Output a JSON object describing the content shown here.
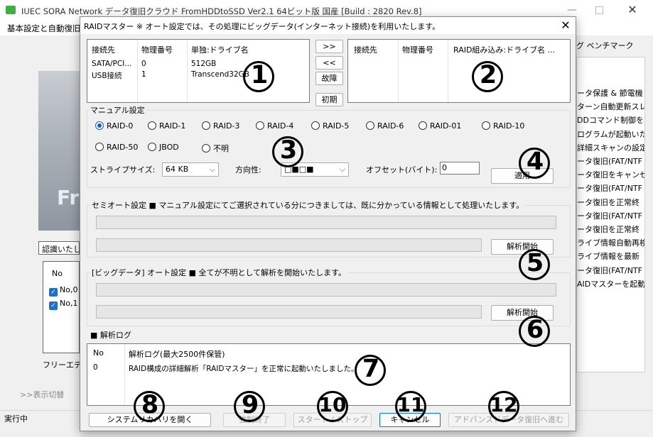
{
  "window": {
    "title": "IUEC SORA Network データ復旧クラウド FromHDDtoSSD Ver2.1 64ビット版 国産 [Build : 2820 Rev.8]",
    "menu_left": "基本設定と自動復旧",
    "menu_right": "グ ベンチマーク",
    "left_panel": {
      "hidden_label": "認識いたし",
      "list_header": "No",
      "rows": [
        "No,0",
        "No,1"
      ],
      "footer": "フリーエデ",
      "toggle": ">>表示切替"
    },
    "right_panel": [
      "ータ保護 & 節電機",
      "ターン自動更新スレ",
      "DDコマンド制御を開",
      "ログラムが起動いた",
      "詳細スキャンの設定を",
      "ータ復旧(FAT/NTF",
      "ータ復旧をキャンセル",
      "ータ復旧(FAT/NTF",
      "ータ復旧を正常終",
      "ータ復旧(FAT/NTF",
      "ータ復旧を正常終",
      "ライブ情報自動再検",
      "ライブ情報を最新",
      "ータ復旧(FAT/NTF",
      "AIDマスターを起動"
    ],
    "status": "実行中"
  },
  "dialog": {
    "title": "RAIDマスター ※ オート設定では、その処理にビッグデータ(インターネット接続)を利用いたします。",
    "source_list": {
      "headers": [
        "接続先",
        "物理番号",
        "単独:ドライブ名"
      ],
      "rows": [
        [
          "SATA/PCI...",
          "0",
          "512GB"
        ],
        [
          "USB接続",
          "1",
          "Transcend32GB"
        ]
      ]
    },
    "target_list": {
      "headers": [
        "接続先",
        "物理番号",
        "RAID組み込み:ドライブ名 ..."
      ]
    },
    "mid_buttons": [
      ">>",
      "<<",
      "故障",
      "初期"
    ],
    "manual": {
      "label": "マニュアル設定",
      "raids": [
        "RAID-0",
        "RAID-1",
        "RAID-3",
        "RAID-4",
        "RAID-5",
        "RAID-6",
        "RAID-01",
        "RAID-10",
        "RAID-50",
        "JBOD",
        "不明"
      ],
      "selected": "RAID-0",
      "stripe_label": "ストライプサイズ:",
      "stripe_value": "64 KB",
      "direction_label": "方向性:",
      "direction_value": "□■□■",
      "offset_label": "オフセット(バイト):",
      "offset_value": "0",
      "apply_button": "適用"
    },
    "semi": {
      "label": "セミオート設定 ■ マニュアル設定にてご選択されている分につきましては、既に分かっている情報として処理いたします。",
      "button": "解析開始"
    },
    "bigdata": {
      "label": "[ビッグデータ] オート設定 ■ 全てが不明として解析を開始いたします。",
      "button": "解析開始"
    },
    "log": {
      "label": "■ 解析ログ",
      "headers": [
        "No",
        "解析ログ(最大2500件保管)"
      ],
      "rows": [
        [
          "0",
          "RAID構成の詳細解析「RAIDマスター」を正常に起動いたしました。"
        ]
      ]
    },
    "bottom_buttons": [
      "システムリカバリを開く",
      "強制終了",
      "スタート / ストップ",
      "キャンセル",
      "アドバンスドデータ復旧へ進む"
    ],
    "markers": [
      "①",
      "②",
      "③",
      "④",
      "⑤",
      "⑥",
      "⑦",
      "⑧",
      "⑨",
      "⑩",
      "⑪",
      "⑫"
    ]
  }
}
